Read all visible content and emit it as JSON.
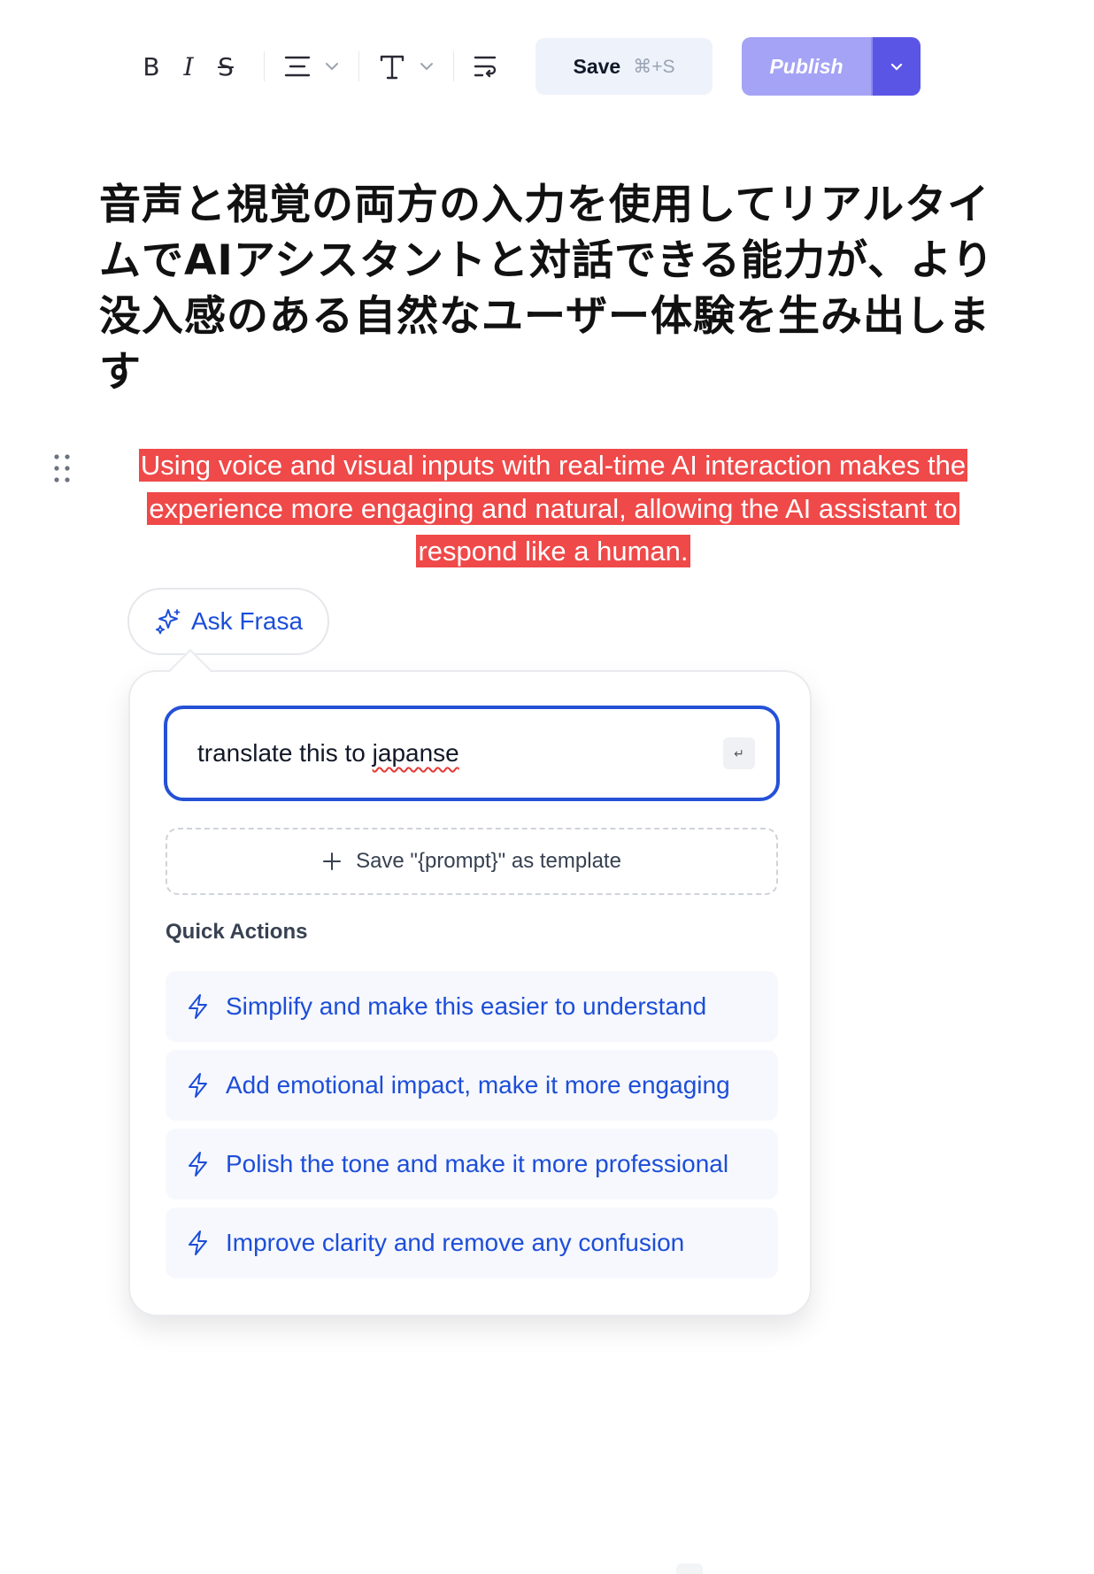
{
  "toolbar": {
    "bold": "B",
    "italic": "I",
    "strike": "S",
    "save_label": "Save",
    "save_shortcut": "⌘+S",
    "publish_label": "Publish"
  },
  "document": {
    "title": "音声と視覚の両方の入力を使用してリアルタイムでAIアシスタントと対話できる能力が、より没入感のある自然なユーザー体験を生み出します",
    "paragraph": "Using voice and visual inputs with real-time AI interaction makes the experience more engaging and natural, allowing the AI assistant to respond like a human."
  },
  "ask_frasa": {
    "label": "Ask Frasa"
  },
  "prompt": {
    "value_prefix": "translate this to ",
    "value_misspelled": "japanse",
    "enter_key": "↵"
  },
  "template": {
    "label": "Save \"{prompt}\" as template"
  },
  "quick_actions": {
    "title": "Quick Actions",
    "items": [
      {
        "label": "Simplify and make this easier to understand"
      },
      {
        "label": "Add emotional impact, make it more engaging"
      },
      {
        "label": "Polish the tone and make it more professional"
      },
      {
        "label": "Improve clarity and remove any confusion"
      }
    ]
  },
  "colors": {
    "highlight": "#ef4949",
    "accent": "#1d4ed8",
    "publish": "#a5a3f5",
    "publish_dropdown": "#5b55e6"
  }
}
